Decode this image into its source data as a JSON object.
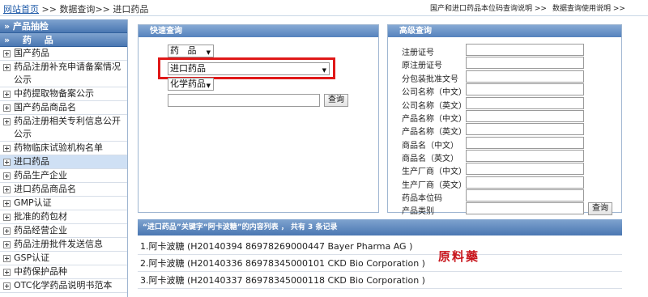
{
  "header": {
    "breadcrumb": {
      "home": "网站首页",
      "sep1": " >> ",
      "level2": "数据查询",
      "sep2": ">> ",
      "current": "进口药品"
    },
    "links": [
      "国产和进口药品本位码查询说明 >>",
      "数据查询使用说明 >>"
    ]
  },
  "sidebar": {
    "heads": [
      "» 产品抽检",
      "» 药    品"
    ],
    "items": [
      {
        "label": "国产药品"
      },
      {
        "label": "药品注册补充申请备案情况公示"
      },
      {
        "label": "中药提取物备案公示"
      },
      {
        "label": "国产药品商品名"
      },
      {
        "label": "药品注册相关专利信息公开公示"
      },
      {
        "label": "药物临床试验机构名单"
      },
      {
        "label": "进口药品"
      },
      {
        "label": "药品生产企业"
      },
      {
        "label": "进口药品商品名"
      },
      {
        "label": "GMP认证"
      },
      {
        "label": "批准的药包材"
      },
      {
        "label": "药品经营企业"
      },
      {
        "label": "药品注册批件发送信息"
      },
      {
        "label": "GSP认证"
      },
      {
        "label": "中药保护品种"
      },
      {
        "label": "OTC化学药品说明书范本"
      }
    ]
  },
  "quick_search": {
    "title": "快速查询",
    "category": "药   品",
    "database": "进口药品",
    "type": "化学药品",
    "keyword": "",
    "query_button": "查询"
  },
  "advanced_search": {
    "title": "高级查询",
    "fields": [
      "注册证号",
      "原注册证号",
      "分包装批准文号",
      "公司名称（中文）",
      "公司名称（英文）",
      "产品名称（中文）",
      "产品名称（英文）",
      "商品名（中文）",
      "商品名（英文）",
      "生产厂商（中文）",
      "生产厂商（英文）",
      "药品本位码",
      "产品类别"
    ],
    "query_button": "查询"
  },
  "results": {
    "header": "“进口药品”关键字“阿卡波糖”的内容列表 ， 共有 3 条记录",
    "rows": [
      "1.阿卡波糖 (H20140394 86978269000447 Bayer Pharma AG )",
      "2.阿卡波糖 (H20140336 86978345000101 CKD Bio Corporation )",
      "3.阿卡波糖 (H20140337 86978345000118 CKD Bio Corporation )"
    ],
    "annotation": "原料藥"
  },
  "colors": {
    "accent": "#4a77b2",
    "highlight": "#e01818",
    "active_item": "#cfe0f4"
  }
}
